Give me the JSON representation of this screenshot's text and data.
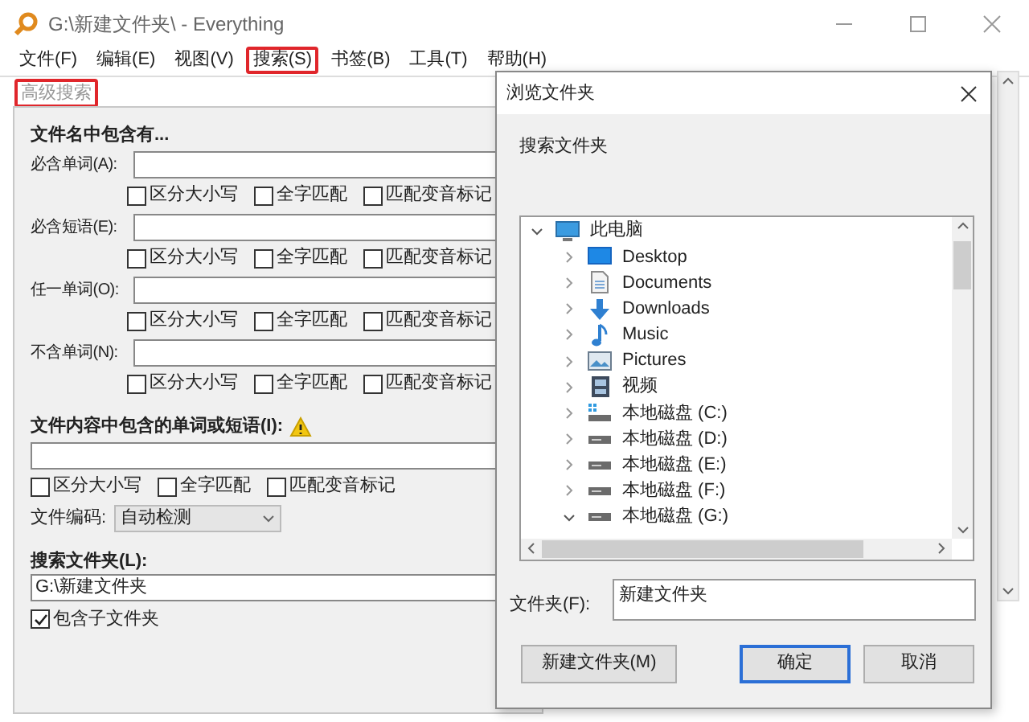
{
  "window": {
    "title": "G:\\新建文件夹\\ - Everything"
  },
  "menu": [
    {
      "label": "文件(F)",
      "highlighted": false
    },
    {
      "label": "编辑(E)",
      "highlighted": false
    },
    {
      "label": "视图(V)",
      "highlighted": false
    },
    {
      "label": "搜索(S)",
      "highlighted": true
    },
    {
      "label": "书签(B)",
      "highlighted": false
    },
    {
      "label": "工具(T)",
      "highlighted": false
    },
    {
      "label": "帮助(H)",
      "highlighted": false
    }
  ],
  "tab": {
    "label": "高级搜索",
    "highlighted": true
  },
  "advanced_search": {
    "heading": "文件名中包含有...",
    "rows": [
      {
        "label": "必含单词(A):",
        "options": [
          {
            "label": "区分大小写",
            "checked": false
          },
          {
            "label": "全字匹配",
            "checked": false
          },
          {
            "label": "匹配变音标记",
            "checked": false
          }
        ]
      },
      {
        "label": "必含短语(E):",
        "options": [
          {
            "label": "区分大小写",
            "checked": false
          },
          {
            "label": "全字匹配",
            "checked": false
          },
          {
            "label": "匹配变音标记",
            "checked": false
          }
        ]
      },
      {
        "label": "任一单词(O):",
        "options": [
          {
            "label": "区分大小写",
            "checked": false
          },
          {
            "label": "全字匹配",
            "checked": false
          },
          {
            "label": "匹配变音标记",
            "checked": false
          }
        ]
      },
      {
        "label": "不含单词(N):",
        "options": [
          {
            "label": "区分大小写",
            "checked": false
          },
          {
            "label": "全字匹配",
            "checked": false
          },
          {
            "label": "匹配变音标记",
            "checked": false
          }
        ]
      }
    ],
    "content_heading": "文件内容中包含的单词或短语(I):",
    "content_options": [
      {
        "label": "区分大小写",
        "checked": false
      },
      {
        "label": "全字匹配",
        "checked": false
      },
      {
        "label": "匹配变音标记",
        "checked": false
      }
    ],
    "encoding_label": "文件编码:",
    "encoding_value": "自动检测",
    "folder_heading": "搜索文件夹(L):",
    "folder_value": "G:\\新建文件夹",
    "subfolders": {
      "label": "包含子文件夹",
      "checked": true
    }
  },
  "browse_dialog": {
    "title": "浏览文件夹",
    "prompt": "搜索文件夹",
    "tree": [
      {
        "label": "此电脑",
        "kind": "computer",
        "expanded": true,
        "children": [
          {
            "label": "Desktop",
            "kind": "desktop",
            "expanded": false
          },
          {
            "label": "Documents",
            "kind": "document",
            "expanded": false
          },
          {
            "label": "Downloads",
            "kind": "download",
            "expanded": false
          },
          {
            "label": "Music",
            "kind": "music",
            "expanded": false
          },
          {
            "label": "Pictures",
            "kind": "pictures",
            "expanded": false
          },
          {
            "label": "视频",
            "kind": "video",
            "expanded": false
          },
          {
            "label": "本地磁盘 (C:)",
            "kind": "system-drive",
            "expanded": false
          },
          {
            "label": "本地磁盘 (D:)",
            "kind": "drive",
            "expanded": false
          },
          {
            "label": "本地磁盘 (E:)",
            "kind": "drive",
            "expanded": false
          },
          {
            "label": "本地磁盘 (F:)",
            "kind": "drive",
            "expanded": false
          },
          {
            "label": "本地磁盘 (G:)",
            "kind": "drive",
            "expanded": true
          }
        ]
      }
    ],
    "folder_label": "文件夹(F):",
    "folder_value": "新建文件夹",
    "buttons": [
      {
        "label": "新建文件夹(M)",
        "default": false
      },
      {
        "label": "确定",
        "default": true
      },
      {
        "label": "取消",
        "default": false
      }
    ]
  }
}
